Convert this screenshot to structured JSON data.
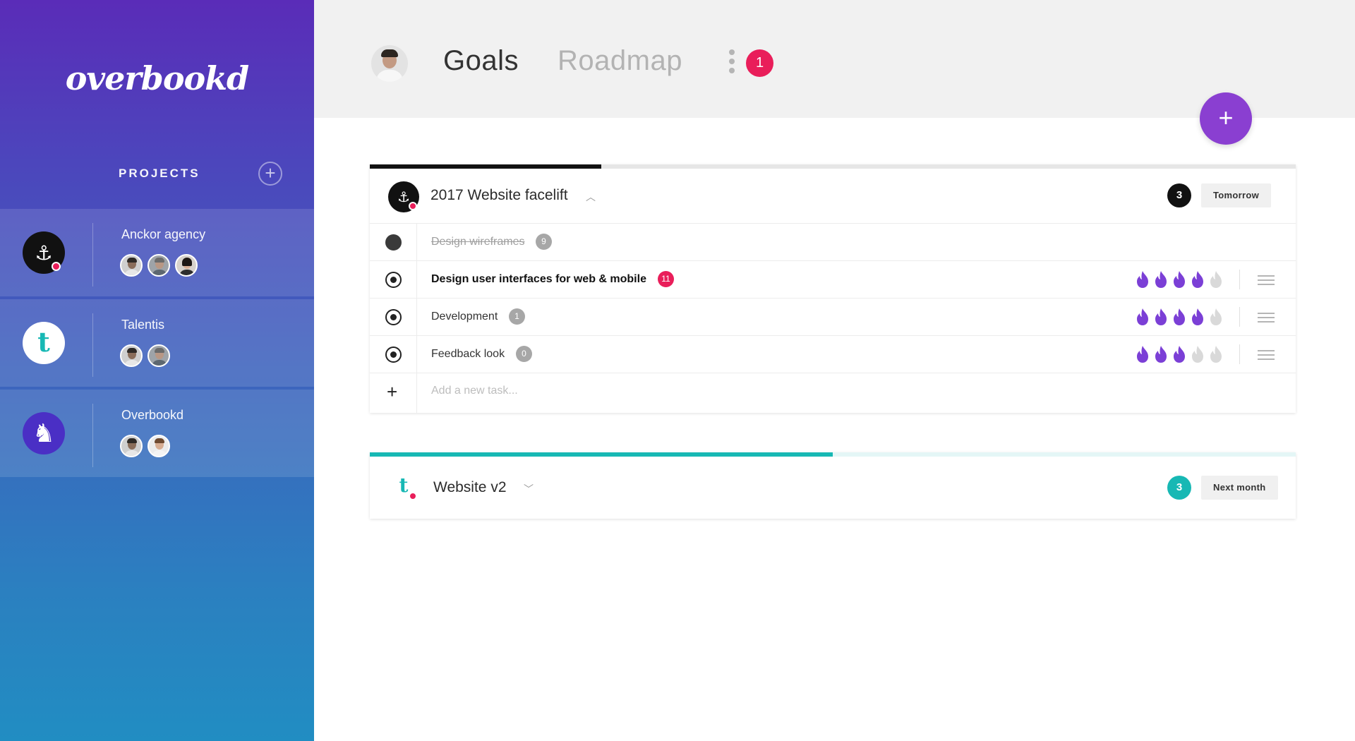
{
  "app": {
    "logo_text": "overbookd"
  },
  "sidebar": {
    "projects_title": "PROJECTS",
    "add_project_label": "+",
    "projects": [
      {
        "name": "Anckor agency",
        "logo_icon": "anchor-icon",
        "logo_bg": "#111111",
        "logo_glyph": "⚓",
        "avatars": 3,
        "unread_dot": true
      },
      {
        "name": "Talentis",
        "logo_icon": "talentis-t-icon",
        "logo_bg": "#ffffff",
        "logo_glyph": "t",
        "avatars": 2,
        "unread_dot": false
      },
      {
        "name": "Overbookd",
        "logo_icon": "horse-head-icon",
        "logo_bg": "#4a2fc5",
        "logo_glyph": "♞",
        "avatars": 2,
        "unread_dot": false
      }
    ]
  },
  "topbar": {
    "tabs": [
      {
        "label": "Goals",
        "active": true
      },
      {
        "label": "Roadmap",
        "active": false
      }
    ],
    "notifications_count": "1",
    "fab_label": "+"
  },
  "cards": [
    {
      "title": "2017 Website facelift",
      "expanded": true,
      "chevron": "︿",
      "progress": 0.25,
      "progress_color": "#111111",
      "count": "3",
      "count_color": "#111111",
      "due_label": "Tomorrow",
      "logo_glyph": "⚓",
      "tasks": [
        {
          "name": "Design wireframes",
          "done": true,
          "comments": "9",
          "comments_highlight": false,
          "priority": null
        },
        {
          "name": "Design user interfaces for web & mobile",
          "done": false,
          "bold": true,
          "comments": "11",
          "comments_highlight": true,
          "priority": 4
        },
        {
          "name": "Development",
          "done": false,
          "comments": "1",
          "comments_highlight": false,
          "priority": 4
        },
        {
          "name": "Feedback look",
          "done": false,
          "comments": "0",
          "comments_highlight": false,
          "priority": 3
        }
      ],
      "add_task_placeholder": "Add a new task...",
      "add_task_icon": "+"
    },
    {
      "title": "Website v2",
      "expanded": false,
      "chevron": "﹀",
      "progress": 0.5,
      "progress_color": "#17b8b4",
      "count": "3",
      "count_color": "#17b8b4",
      "due_label": "Next month",
      "logo_glyph": "t"
    }
  ],
  "colors": {
    "accent_purple": "#8a3fd1",
    "notification_red": "#e91e5a",
    "teal": "#17b8b4",
    "flame_active": "#7b3fd6",
    "flame_inactive": "#d9d9d9"
  },
  "priority_max": 5
}
